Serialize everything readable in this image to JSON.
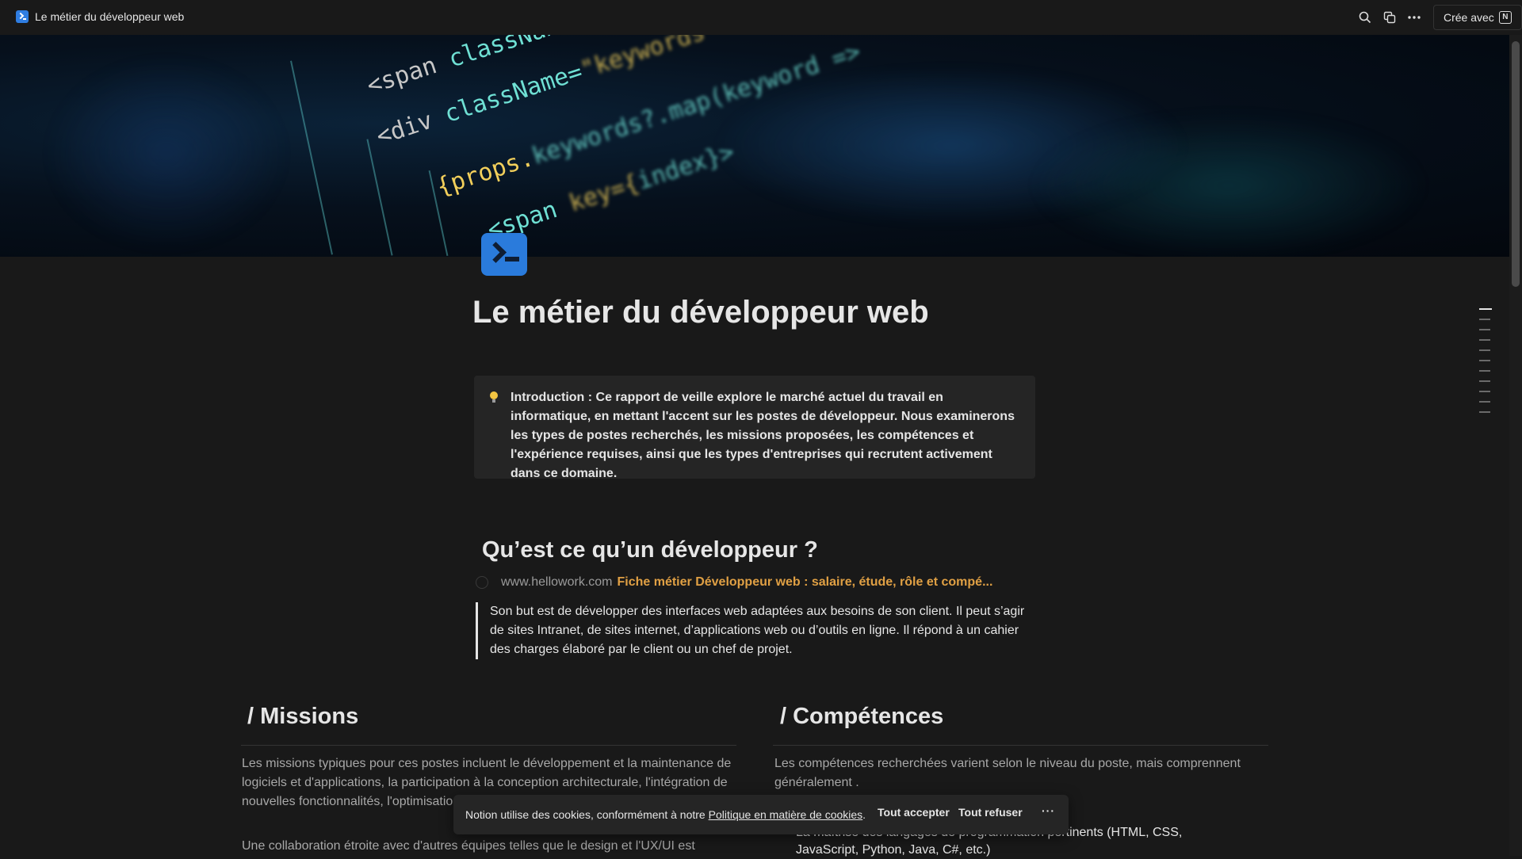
{
  "topbar": {
    "title": "Le métier du développeur web",
    "create_label": "Crée avec",
    "icons": [
      "search-icon",
      "duplicate-icon",
      "more-icon",
      "notion-icon"
    ]
  },
  "cover": {
    "code_lines": [
      {
        "tag": "<span",
        "attr": " className=",
        "val": "\"...\""
      },
      {
        "tag": "<div",
        "attr": " className=",
        "val": "\"keywords\">"
      },
      {
        "tag": "{props.",
        "attr": "keywords?.map(",
        "val": "keyword =>"
      },
      {
        "tag": "<span",
        "attr": " key={",
        "val": "index}>"
      }
    ]
  },
  "page": {
    "title": "Le métier du développeur web",
    "callout": "Introduction : Ce rapport de veille explore le marché actuel du travail en informatique, en mettant l'accent sur les postes de développeur. Nous examinerons les types de postes recherchés, les missions proposées, les compétences et l'expérience requises, ainsi que les types d'entreprises qui recrutent activement dans ce domaine.",
    "section1": {
      "heading": "Qu’est ce qu’un développeur ?",
      "link_domain": "www.hellowork.com",
      "link_title": "Fiche métier Développeur web : salaire, étude, rôle et compé...",
      "quote": "Son but est de développer des interfaces web adaptées aux besoins de son client. Il peut s’agir de sites Intranet, de sites internet, d’applications web ou d’outils en ligne. Il répond à un cahier des charges élaboré par le client ou un chef de projet."
    },
    "missions": {
      "heading": "/ Missions",
      "para1": "Les missions typiques pour ces postes incluent le développement et la maintenance de logiciels et d'applications, la participation à la conception architecturale, l'intégration de nouvelles fonctionnalités, l'optimisation des performances, les tests et le débogage.",
      "para2": "Une collaboration étroite avec d'autres équipes telles que le design et l'UX/UI est"
    },
    "competences": {
      "heading": "/ Compétences",
      "para1": "Les compétences recherchées varient selon le niveau du poste, mais comprennent généralement .",
      "bullet1": "La maîtrise des langages de programmation pertinents (HTML, CSS, JavaScript, Python, Java, C#, etc.)"
    }
  },
  "cookie": {
    "message": "Notion utilise des cookies, conformément à notre ",
    "link": "Politique en matière de cookies",
    "suffix": ".",
    "accept": "Tout accepter",
    "refuse": "Tout refuser",
    "more": "···"
  },
  "colors": {
    "background": "#191919",
    "callout_bg": "#252525",
    "link_accent": "#e0a044",
    "icon_blue": "#2a7bdc"
  }
}
